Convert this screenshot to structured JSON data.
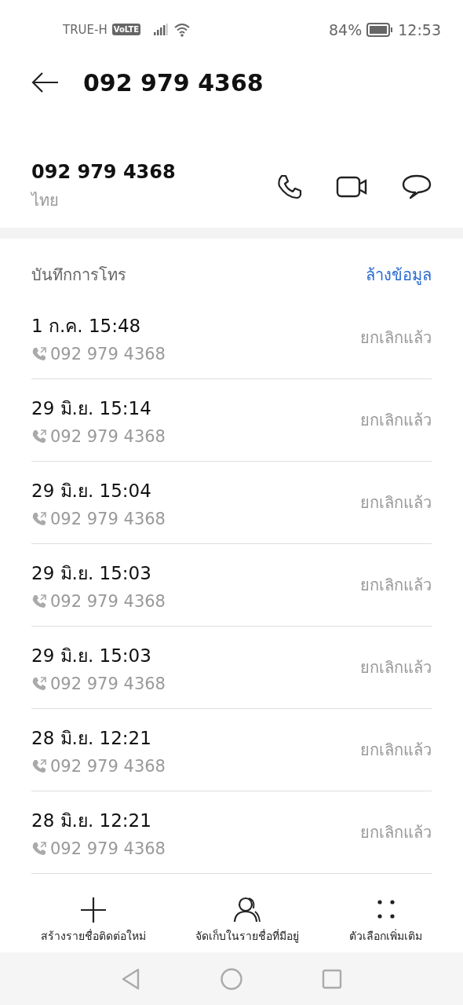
{
  "status_bar": {
    "carrier": "TRUE-H",
    "volte": "VoLTE",
    "battery": "84%",
    "time": "12:53"
  },
  "header": {
    "title": "092 979 4368"
  },
  "contact": {
    "number": "092 979 4368",
    "region": "ไทย"
  },
  "call_log": {
    "title": "บันทึกการโทร",
    "clear": "ล้างข้อมูล",
    "entries": [
      {
        "when": "1 ก.ค. 15:48",
        "number": "092 979 4368",
        "status": "ยกเลิกแล้ว"
      },
      {
        "when": "29 มิ.ย. 15:14",
        "number": "092 979 4368",
        "status": "ยกเลิกแล้ว"
      },
      {
        "when": "29 มิ.ย. 15:04",
        "number": "092 979 4368",
        "status": "ยกเลิกแล้ว"
      },
      {
        "when": "29 มิ.ย. 15:03",
        "number": "092 979 4368",
        "status": "ยกเลิกแล้ว"
      },
      {
        "when": "29 มิ.ย. 15:03",
        "number": "092 979 4368",
        "status": "ยกเลิกแล้ว"
      },
      {
        "when": "28 มิ.ย. 12:21",
        "number": "092 979 4368",
        "status": "ยกเลิกแล้ว"
      },
      {
        "when": "28 มิ.ย. 12:21",
        "number": "092 979 4368",
        "status": "ยกเลิกแล้ว"
      }
    ]
  },
  "actions": [
    {
      "kind": "add",
      "label": "สร้างรายชื่อติดต่อใหม่"
    },
    {
      "kind": "contacts",
      "label": "จัดเก็บในรายชื่อที่มีอยู่"
    },
    {
      "kind": "more",
      "label": "ตัวเลือกเพิ่มเติม"
    }
  ]
}
